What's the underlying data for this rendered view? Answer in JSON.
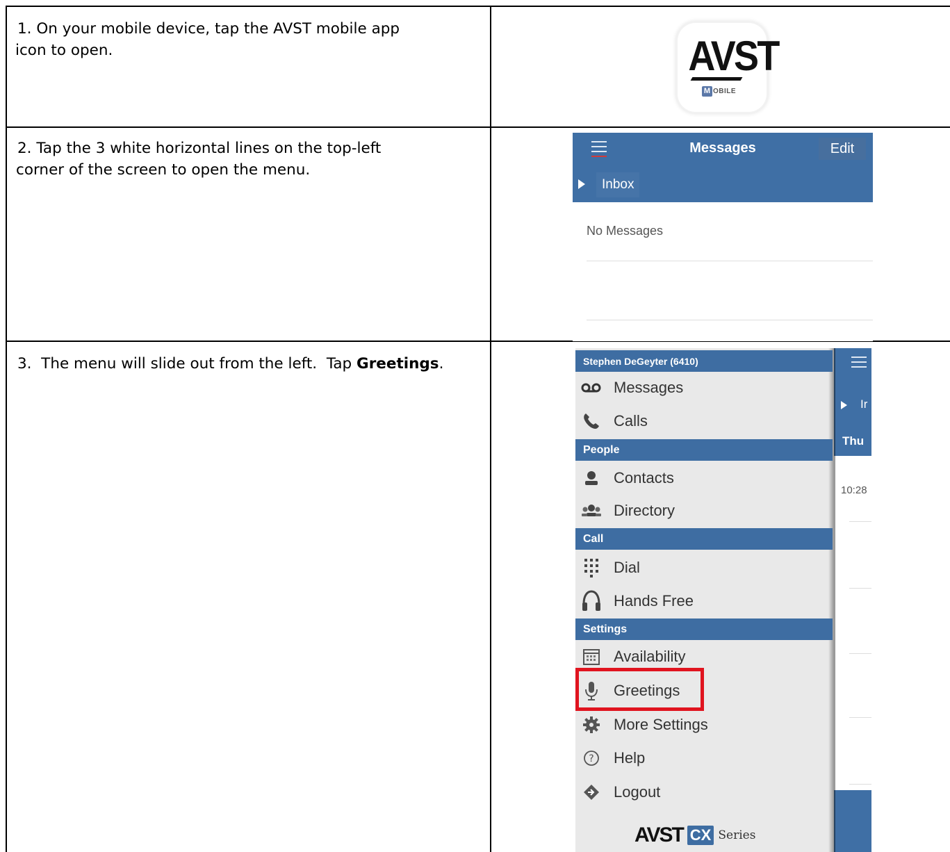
{
  "steps": [
    {
      "line1": "1.  On your mobile device, tap the AVST mobile app",
      "line2": "icon to open."
    },
    {
      "line1": "2.  Tap the 3 white horizontal lines on the top-left",
      "line2": "corner of the screen to open the menu."
    },
    {
      "prefix": "3.  The menu will slide out from the left.  Tap ",
      "bold": "Greetings",
      "suffix": "."
    }
  ],
  "app_icon": {
    "logo_text": "AVST",
    "badge_letter": "M",
    "badge_rest": "OBILE"
  },
  "messages_screen": {
    "title": "Messages",
    "edit_label": "Edit",
    "inbox_label": "Inbox",
    "empty_text": "No Messages",
    "header_color": "#3f6fa5"
  },
  "menu_screen": {
    "user_header": "Stephen DeGeyter (6410)",
    "sections": [
      {
        "header": "",
        "items": [
          {
            "label": "Messages",
            "icon": "voicemail-icon"
          },
          {
            "label": "Calls",
            "icon": "phone-icon"
          }
        ]
      },
      {
        "header": "People",
        "items": [
          {
            "label": "Contacts",
            "icon": "contact-icon"
          },
          {
            "label": "Directory",
            "icon": "directory-icon"
          }
        ]
      },
      {
        "header": "Call",
        "items": [
          {
            "label": "Dial",
            "icon": "dialpad-icon"
          },
          {
            "label": "Hands Free",
            "icon": "headset-icon"
          }
        ]
      },
      {
        "header": "Settings",
        "items": [
          {
            "label": "Availability",
            "icon": "calendar-icon"
          },
          {
            "label": "Greetings",
            "icon": "microphone-icon"
          },
          {
            "label": "More Settings",
            "icon": "gear-icon"
          },
          {
            "label": "Help",
            "icon": "help-icon"
          },
          {
            "label": "Logout",
            "icon": "logout-icon"
          }
        ]
      }
    ],
    "right_pane": {
      "inbox_partial": "Ir",
      "date_partial": "Thu",
      "time_partial": "10:28"
    },
    "footer": {
      "brand": "AVST",
      "cx": "CX",
      "series": "Series"
    },
    "highlight_color": "#e0141f"
  }
}
